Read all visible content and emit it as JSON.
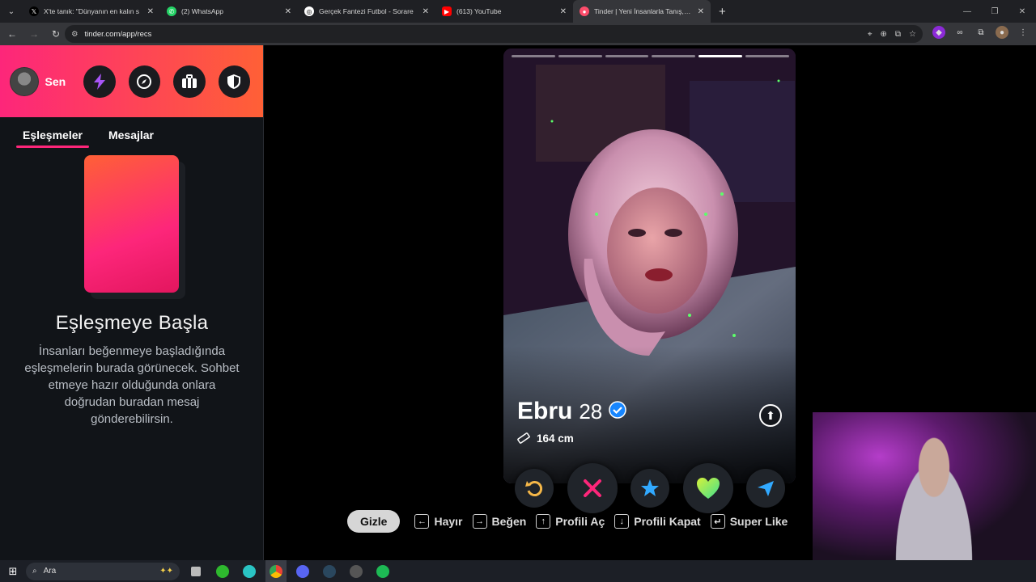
{
  "browser": {
    "tabs": [
      {
        "title": "X'te tanık: \"Dünyanın en kalın s",
        "icon": "x-logo-icon",
        "active": false
      },
      {
        "title": "(2) WhatsApp",
        "icon": "whatsapp-icon",
        "active": false
      },
      {
        "title": "Gerçek Fantezi Futbol - Sorare",
        "icon": "sorare-icon",
        "active": false
      },
      {
        "title": "(613) YouTube",
        "icon": "youtube-icon",
        "active": false
      },
      {
        "title": "Tinder | Yeni İnsanlarla Tanış, Bu",
        "icon": "tinder-icon",
        "active": true
      }
    ],
    "url": "tinder.com/app/recs"
  },
  "sidebar": {
    "user_label": "Sen",
    "tabs": [
      "Eşleşmeler",
      "Mesajlar"
    ],
    "active_tab": "Eşleşmeler",
    "empty_title": "Eşleşmeye Başla",
    "empty_desc": "İnsanları beğenmeye başladığında eşleşmelerin burada görünecek. Sohbet etmeye hazır olduğunda onlara doğrudan buradan mesaj gönderebilirsin."
  },
  "profile": {
    "name": "Ebru",
    "age": "28",
    "height": "164 cm",
    "photo_count": 6,
    "active_photo": 5,
    "verified": true
  },
  "shortcuts": {
    "hide_label": "Gizle",
    "items": [
      {
        "key": "←",
        "label": "Hayır"
      },
      {
        "key": "→",
        "label": "Beğen"
      },
      {
        "key": "↑",
        "label": "Profili Aç"
      },
      {
        "key": "↓",
        "label": "Profili Kapat"
      },
      {
        "key": "↵",
        "label": "Super Like"
      }
    ]
  },
  "taskbar": {
    "search_placeholder": "Ara"
  },
  "colors": {
    "brand_gradient_start": "#fd267a",
    "brand_gradient_end": "#ff6036",
    "rewind": "#f5b748",
    "nope": "#fd267a",
    "superlike": "#31a9ff",
    "like": "#56e08a",
    "boost": "#31a9ff"
  }
}
